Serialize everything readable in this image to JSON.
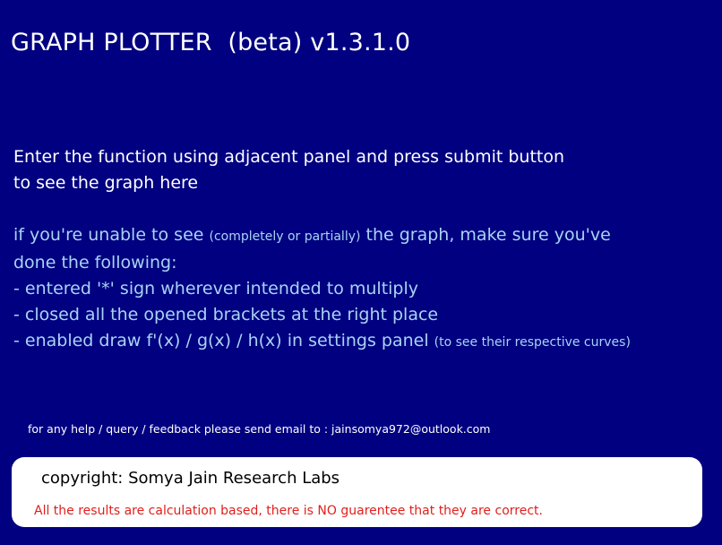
{
  "header": {
    "title": "GRAPH PLOTTER  (beta) v1.3.1.0"
  },
  "intro": {
    "line1": "Enter the function using adjacent panel and press submit button",
    "line2": "to see the graph here"
  },
  "tips": {
    "lead_part1": "if you're unable to see ",
    "lead_small": "(completely or partially)",
    "lead_part2": " the graph, make sure you've",
    "lead_line2": "done the following:",
    "item1": "- entered '*' sign wherever intended to multiply",
    "item2": "- closed all the opened brackets at the right place",
    "item3_main": "- enabled draw f'(x) / g(x) / h(x) in settings panel ",
    "item3_small": "(to see their respective curves)"
  },
  "help": {
    "text": "for any help / query / feedback please send email to : jainsomya972@outlook.com"
  },
  "footer": {
    "copyright": "copyright: Somya Jain Research Labs",
    "disclaimer": "All the results are calculation based, there is NO guarentee that they are correct."
  },
  "colors": {
    "background": "#000080",
    "title_text": "#ffffff",
    "tips_text": "#a9d3f5",
    "disclaimer_text": "#e0201c",
    "panel": "#ffffff"
  }
}
